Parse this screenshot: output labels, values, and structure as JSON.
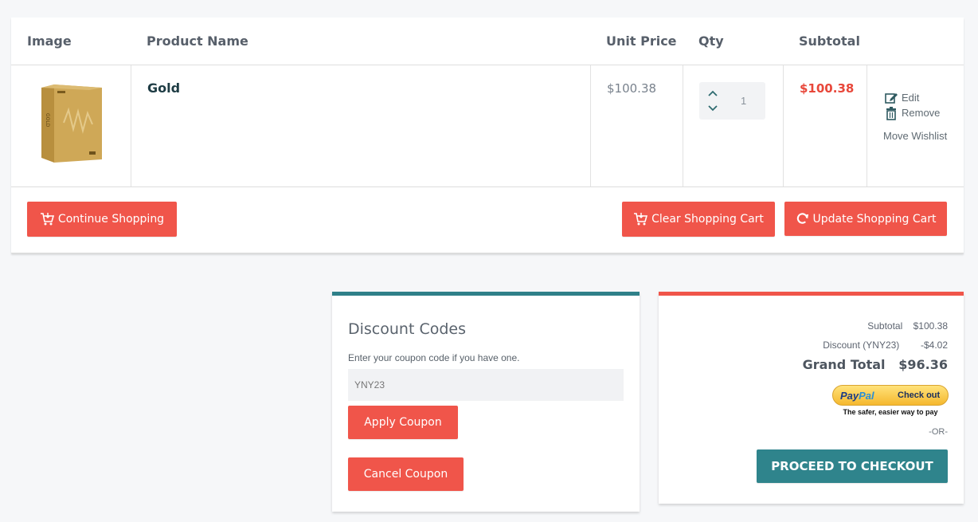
{
  "table": {
    "headers": {
      "image": "Image",
      "product_name": "Product Name",
      "unit_price": "Unit Price",
      "qty": "Qty",
      "subtotal": "Subtotal"
    },
    "items": [
      {
        "name": "Gold",
        "unit_price": "$100.38",
        "qty": "1",
        "subtotal": "$100.38",
        "actions": {
          "edit": "Edit",
          "remove": "Remove",
          "wishlist": "Move Wishlist"
        }
      }
    ]
  },
  "buttons": {
    "continue_shopping": "Continue Shopping",
    "clear_cart": "Clear Shopping Cart",
    "update_cart": "Update Shopping Cart"
  },
  "discount": {
    "title": "Discount Codes",
    "description": "Enter your coupon code if you have one.",
    "coupon_value": "YNY23",
    "apply": "Apply Coupon",
    "cancel": "Cancel Coupon"
  },
  "totals": {
    "subtotal_label": "Subtotal",
    "subtotal_value": "$100.38",
    "discount_label": "Discount (YNY23)",
    "discount_value": "-$4.02",
    "grand_label": "Grand Total",
    "grand_value": "$96.36",
    "paypal": {
      "brand_1": "Pay",
      "brand_2": "Pal",
      "checkout": "Check out",
      "tagline": "The safer, easier way to pay"
    },
    "or": "-OR-",
    "checkout": "PROCEED TO CHECKOUT"
  },
  "colors": {
    "accent_red": "#f0554a",
    "accent_teal": "#2f848c",
    "price_red": "#e8473a"
  }
}
